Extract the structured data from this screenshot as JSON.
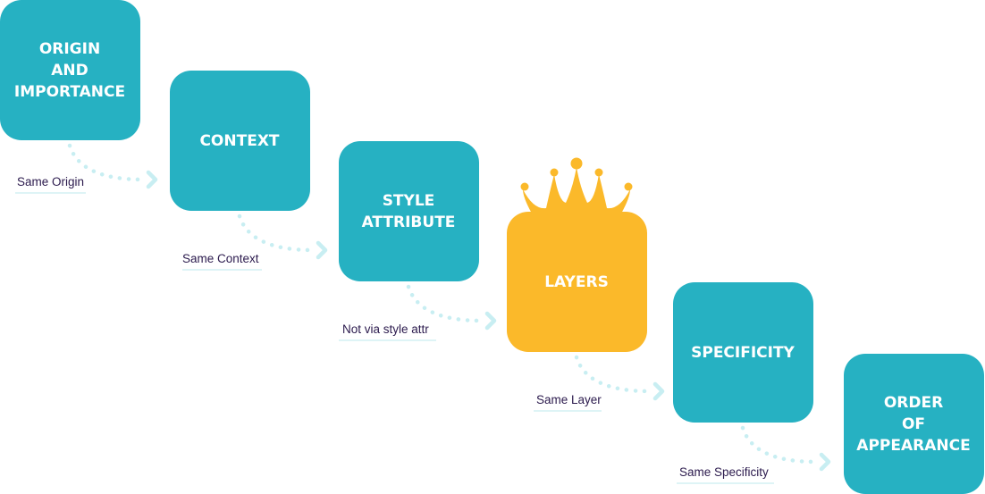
{
  "colors": {
    "step": "#26b1c2",
    "highlight": "#fbb92a",
    "connector": "#c8eef2",
    "label": "#2b1a4d"
  },
  "steps": [
    {
      "lines": [
        "ORIGIN",
        "AND",
        "IMPORTANCE"
      ],
      "highlight": false
    },
    {
      "lines": [
        "CONTEXT"
      ],
      "highlight": false
    },
    {
      "lines": [
        "STYLE",
        "ATTRIBUTE"
      ],
      "highlight": false
    },
    {
      "lines": [
        "LAYERS"
      ],
      "highlight": true,
      "icon": "crown-icon"
    },
    {
      "lines": [
        "SPECIFICITY"
      ],
      "highlight": false
    },
    {
      "lines": [
        "ORDER",
        "OF",
        "APPEARANCE"
      ],
      "highlight": false
    }
  ],
  "connectors": [
    "Same Origin",
    "Same Context",
    "Not via style attr",
    "Same Layer",
    "Same Specificity"
  ]
}
